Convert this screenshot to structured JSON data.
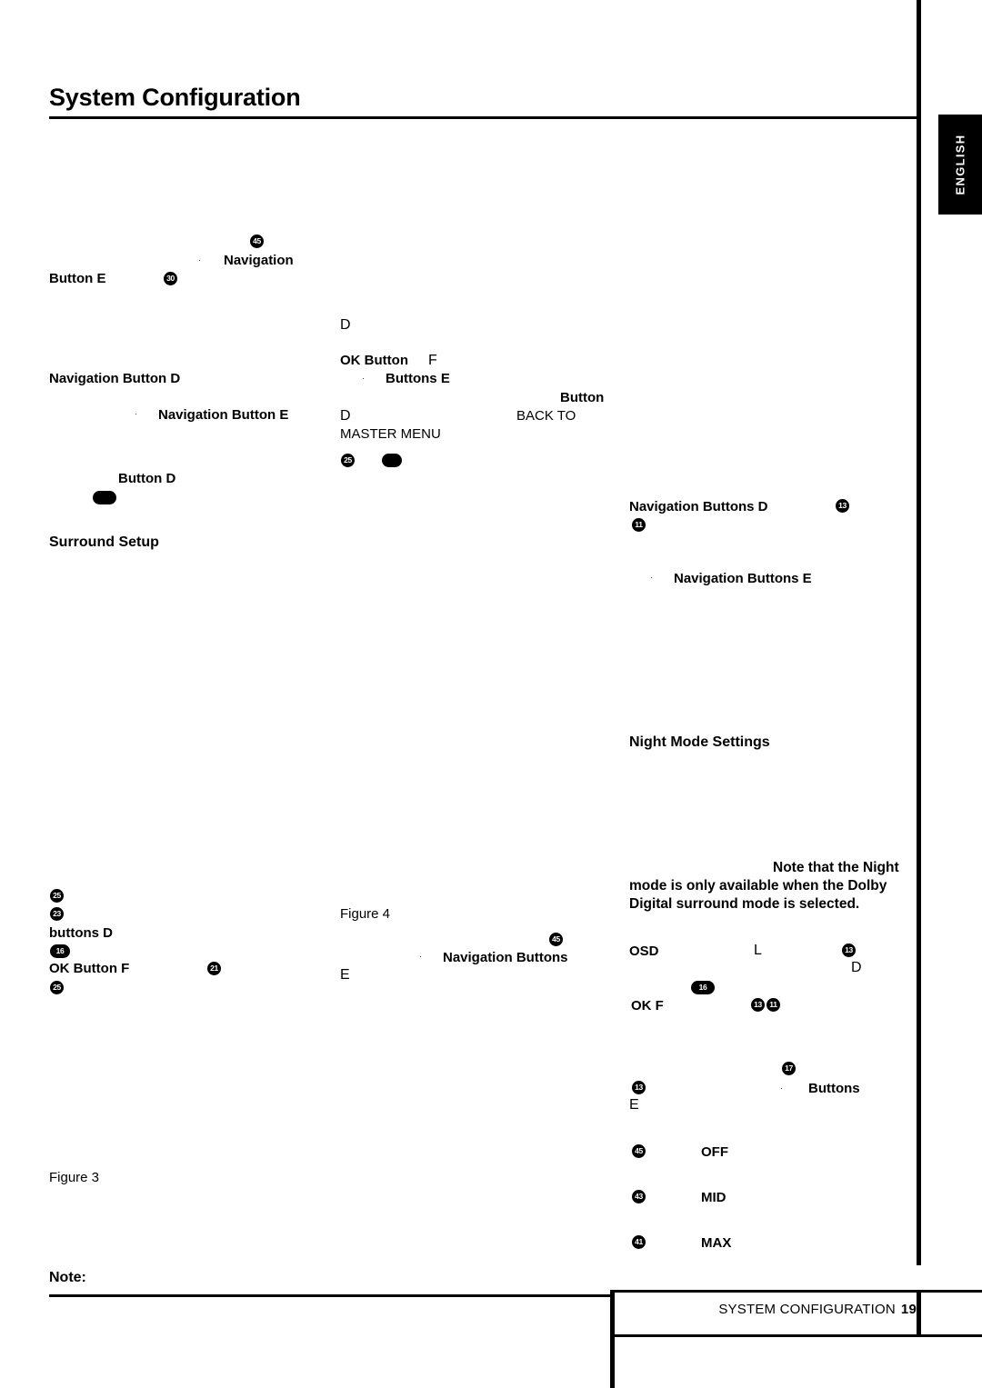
{
  "page": {
    "title": "System Configuration",
    "side_tab": "ENGLISH",
    "footer": {
      "label": "SYSTEM CONFIGURATION",
      "page_number": "19"
    },
    "note_label": "Note:"
  },
  "columns": {
    "left": {
      "fragments": [
        {
          "id": "button-e",
          "text": "Button E",
          "bold_part": "Button",
          "plain_part": "E"
        },
        {
          "id": "navigation-button-d",
          "text": "Navigation Button D"
        },
        {
          "id": "navigation-button-e",
          "text": "Navigation Button E"
        },
        {
          "id": "button-d",
          "text": "Button D"
        },
        {
          "id": "surround-setup-heading",
          "text": "Surround Setup"
        },
        {
          "id": "buttons-d",
          "text": "buttons D"
        },
        {
          "id": "ok-button-f",
          "text": "OK Button F"
        },
        {
          "id": "figure-3",
          "text": "Figure 3"
        }
      ]
    },
    "middle": {
      "fragments": [
        {
          "id": "letter-d-top",
          "text": "D"
        },
        {
          "id": "ok-button-f-mid",
          "text": "OK Button",
          "suffix": "F"
        },
        {
          "id": "buttons-e-mid",
          "text": "Buttons E"
        },
        {
          "id": "letter-d-mid",
          "text": "D"
        },
        {
          "id": "master-menu",
          "text": "MASTER MENU"
        },
        {
          "id": "figure-4",
          "text": "Figure 4"
        },
        {
          "id": "navigation-buttons-mid",
          "text": "Navigation Buttons"
        },
        {
          "id": "letter-e-mid",
          "text": "E"
        }
      ]
    },
    "right": {
      "fragments": [
        {
          "id": "button-right",
          "text": "Button"
        },
        {
          "id": "back-to",
          "text": "BACK TO"
        },
        {
          "id": "navigation-buttons-d",
          "text": "Navigation Buttons D"
        },
        {
          "id": "navigation-buttons-e",
          "text": "Navigation Buttons E"
        },
        {
          "id": "night-mode-heading",
          "text": "Night Mode Settings"
        },
        {
          "id": "night-mode-note",
          "text": "Note that the Night mode is only available when the Dolby Digital surround mode is selected."
        },
        {
          "id": "osd",
          "text": "OSD"
        },
        {
          "id": "letter-l",
          "text": "L"
        },
        {
          "id": "letter-d-right",
          "text": "D"
        },
        {
          "id": "ok-f",
          "text": "OK F"
        },
        {
          "id": "buttons-right",
          "text": "Buttons"
        },
        {
          "id": "letter-e-right",
          "text": "E"
        }
      ],
      "night_mode_options": [
        {
          "badge": "45",
          "label": "OFF"
        },
        {
          "badge": "43",
          "label": "MID"
        },
        {
          "badge": "41",
          "label": "MAX"
        }
      ]
    }
  },
  "badges": {
    "b_45_nav_top": "45",
    "b_30_button_e": "30",
    "b_25_master": "25",
    "b_dot_master": "",
    "b_25_surround": "25",
    "b_blob_surround": "",
    "b_13_nav_d": "13",
    "b_11_nav_d": "11",
    "b_25_left_low": "25",
    "b_23_left_low": "23",
    "b_16_left_low": "16",
    "b_25_left_low2": "25",
    "b_21_left_ok": "21",
    "b_45_mid": "45",
    "b_13_osd": "13",
    "b_16_osd": "16",
    "b_13_ok": "13",
    "b_11_ok": "11",
    "b_17_buttons": "17",
    "b_13_buttons": "13",
    "b_45_off": "45",
    "b_43_mid": "43",
    "b_41_max": "41"
  }
}
